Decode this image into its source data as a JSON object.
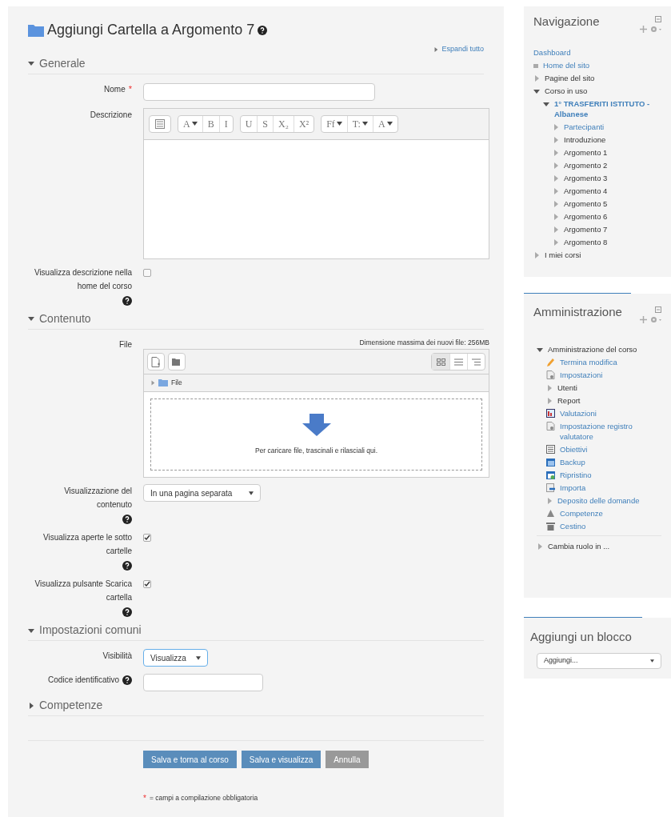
{
  "page": {
    "title": "Aggiungi Cartella a Argomento 7",
    "expand_all": "Espandi tutto"
  },
  "sections": [
    {
      "title": "Generale",
      "expanded": true,
      "fields": [
        {
          "kind": "text",
          "label": "Nome",
          "required_mark": "*"
        },
        {
          "kind": "editor",
          "label": "Descrizione",
          "toolbar": [
            [
              {
                "kind": "icon"
              }
            ],
            [
              {
                "kind": "text",
                "label": "A",
                "dropdown": true
              },
              {
                "kind": "text",
                "label": "B"
              },
              {
                "kind": "text",
                "label": "I"
              }
            ],
            [
              {
                "kind": "text",
                "label": "U"
              },
              {
                "kind": "text",
                "label": "S"
              },
              {
                "kind": "text",
                "label": "X₂"
              },
              {
                "kind": "text",
                "label": "X²"
              }
            ],
            [
              {
                "kind": "text",
                "label": "Ff",
                "dropdown": true
              },
              {
                "kind": "text",
                "label": "T:",
                "dropdown": true
              },
              {
                "kind": "text",
                "label": "A",
                "dropdown": true
              }
            ]
          ]
        },
        {
          "kind": "checkbox",
          "label": "Visualizza descrizione nella home del corso",
          "help": true,
          "checked": false
        }
      ]
    },
    {
      "title": "Contenuto",
      "expanded": true,
      "fields": [
        {
          "kind": "files",
          "label": "File",
          "max_size": "Dimensione massima dei nuovi file: 256MB",
          "folder": "File",
          "drop_hint": "Per caricare file, trascinali e rilasciali qui."
        },
        {
          "kind": "select",
          "label": "Visualizzazione del contenuto",
          "help": true,
          "value": "In una pagina separata"
        },
        {
          "kind": "checkbox",
          "label": "Visualizza aperte le sotto cartelle",
          "help": true,
          "checked": true
        },
        {
          "kind": "checkbox",
          "label": "Visualizza pulsante Scarica cartella",
          "help": true,
          "checked": true
        }
      ]
    },
    {
      "title": "Impostazioni comuni",
      "expanded": true,
      "fields": [
        {
          "kind": "select",
          "label": "Visibilità",
          "value": "Visualizza",
          "focused": true
        },
        {
          "kind": "text",
          "label": "Codice identificativo",
          "help": true,
          "inline_help": true
        }
      ]
    },
    {
      "title": "Competenze",
      "expanded": false
    }
  ],
  "buttons": [
    {
      "label": "Salva e torna al corso",
      "kind": "primary"
    },
    {
      "label": "Salva e visualizza",
      "kind": "primary"
    },
    {
      "label": "Annulla",
      "kind": "secondary"
    }
  ],
  "required_note": {
    "mark": "*",
    "text": "= campi a compilazione obbligatoria"
  },
  "navigation": {
    "title": "Navigazione",
    "items": [
      {
        "label": "Dashboard",
        "link": true,
        "kind": "plain"
      },
      {
        "label": "Home del sito",
        "link": true,
        "kind": "leaf"
      },
      {
        "label": "Pagine del sito",
        "link": false,
        "kind": "branch",
        "expanded": false
      },
      {
        "label": "Corso in uso",
        "link": false,
        "kind": "branch",
        "expanded": true,
        "children": [
          {
            "label": "1° TRASFERITI ISTITUTO - Albanese",
            "link": true,
            "bold": true,
            "kind": "branch",
            "expanded": true,
            "children": [
              {
                "label": "Partecipanti",
                "link": true,
                "kind": "branch",
                "expanded": false
              },
              {
                "label": "Introduzione",
                "link": false,
                "kind": "branch",
                "expanded": false
              },
              {
                "label": "Argomento 1",
                "link": false,
                "kind": "branch",
                "expanded": false
              },
              {
                "label": "Argomento 2",
                "link": false,
                "kind": "branch",
                "expanded": false
              },
              {
                "label": "Argomento 3",
                "link": false,
                "kind": "branch",
                "expanded": false
              },
              {
                "label": "Argomento 4",
                "link": false,
                "kind": "branch",
                "expanded": false
              },
              {
                "label": "Argomento 5",
                "link": false,
                "kind": "branch",
                "expanded": false
              },
              {
                "label": "Argomento 6",
                "link": false,
                "kind": "branch",
                "expanded": false
              },
              {
                "label": "Argomento 7",
                "link": false,
                "kind": "branch",
                "expanded": false
              },
              {
                "label": "Argomento 8",
                "link": false,
                "kind": "branch",
                "expanded": false
              }
            ]
          }
        ]
      },
      {
        "label": "I miei corsi",
        "link": false,
        "kind": "branch",
        "expanded": false
      }
    ]
  },
  "administration": {
    "title": "Amministrazione",
    "items": [
      {
        "label": "Amministrazione del corso",
        "kind": "branch",
        "expanded": true,
        "link": false,
        "children": [
          {
            "label": "Termina modifica",
            "kind": "pencil",
            "link": true
          },
          {
            "label": "Impostazioni",
            "kind": "document",
            "link": true
          },
          {
            "label": "Utenti",
            "kind": "branch",
            "expanded": false,
            "link": false
          },
          {
            "label": "Report",
            "kind": "branch",
            "expanded": false,
            "link": false
          },
          {
            "label": "Valutazioni",
            "kind": "grades",
            "link": true
          },
          {
            "label": "Impostazione registro valutatore",
            "kind": "document",
            "link": true
          },
          {
            "label": "Obiettivi",
            "kind": "list",
            "link": true
          },
          {
            "label": "Backup",
            "kind": "window",
            "link": true
          },
          {
            "label": "Ripristino",
            "kind": "restore",
            "link": true
          },
          {
            "label": "Importa",
            "kind": "import",
            "link": true
          },
          {
            "label": "Deposito delle domande",
            "kind": "branch",
            "expanded": false,
            "link": true
          },
          {
            "label": "Competenze",
            "kind": "cone",
            "link": true
          },
          {
            "label": "Cestino",
            "kind": "trash",
            "link": true
          }
        ]
      },
      {
        "label": "Cambia ruolo in ...",
        "kind": "branch",
        "expanded": false,
        "link": false
      }
    ]
  },
  "add_block": {
    "title": "Aggiungi un blocco",
    "value": "Aggiungi..."
  }
}
